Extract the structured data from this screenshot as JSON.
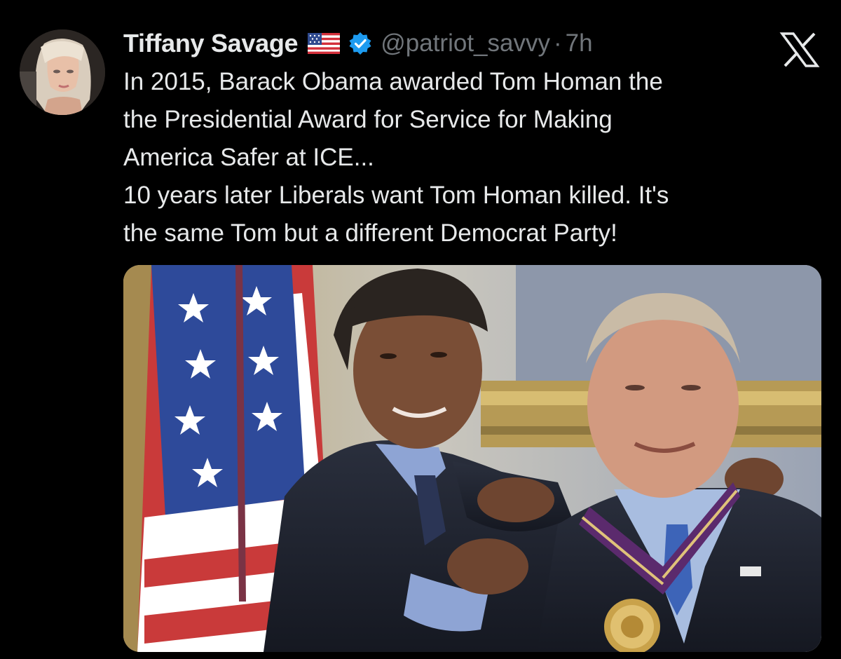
{
  "author": {
    "display_name": "Tiffany Savage",
    "flag": "flag-us-icon",
    "verified": true,
    "handle": "@patriot_savvy",
    "separator": "·",
    "time": "7h"
  },
  "platform_logo": "x-logo-icon",
  "tweet": {
    "lines": [
      "In 2015, Barack Obama awarded Tom Homan the",
      "the Presidential Award for Service for Making",
      "America Safer at ICE...",
      "10 years later Liberals want Tom Homan killed. It's",
      "the same Tom but a different Democrat Party!"
    ]
  },
  "media": {
    "type": "photo",
    "alt": "medal-ceremony-photo"
  },
  "colors": {
    "background": "#000000",
    "text_primary": "#e7e9ea",
    "text_secondary": "#71767b",
    "verified_blue": "#1d9bf0"
  }
}
